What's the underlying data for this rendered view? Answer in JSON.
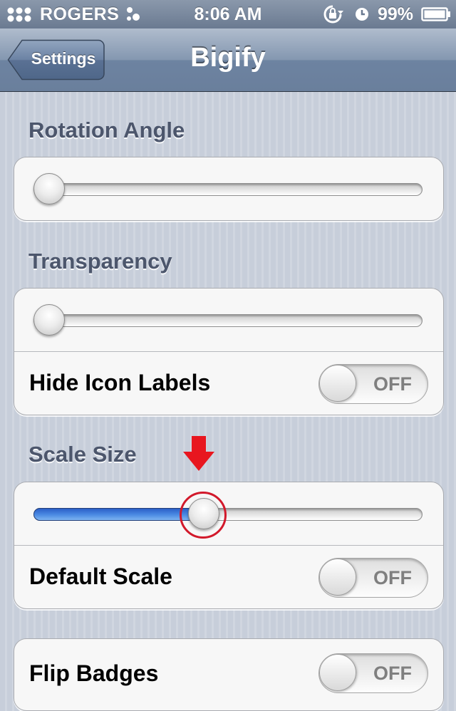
{
  "status_bar": {
    "carrier": "ROGERS",
    "time": "8:06 AM",
    "battery_percent": "99%",
    "icons": [
      "signal-dots-icon",
      "wifi-dots-icon",
      "rotation-lock-icon",
      "alarm-icon",
      "battery-icon"
    ]
  },
  "nav": {
    "title": "Bigify",
    "back_label": "Settings"
  },
  "sections": {
    "rotation": {
      "header": "Rotation Angle",
      "slider_value": 0
    },
    "transparency": {
      "header": "Transparency",
      "slider_value": 0,
      "hide_icon_labels": {
        "label": "Hide Icon Labels",
        "state": "OFF"
      }
    },
    "scale": {
      "header": "Scale Size",
      "slider_value": 0.43,
      "default_scale": {
        "label": "Default Scale",
        "state": "OFF"
      }
    },
    "flip_badges": {
      "label": "Flip Badges",
      "state": "OFF"
    }
  },
  "annotations": {
    "arrow_color": "#e8161f",
    "ring_color": "#d2192b"
  },
  "colors": {
    "slider_fill": "#3a74d8",
    "nav_bar": "#6d83a1"
  }
}
